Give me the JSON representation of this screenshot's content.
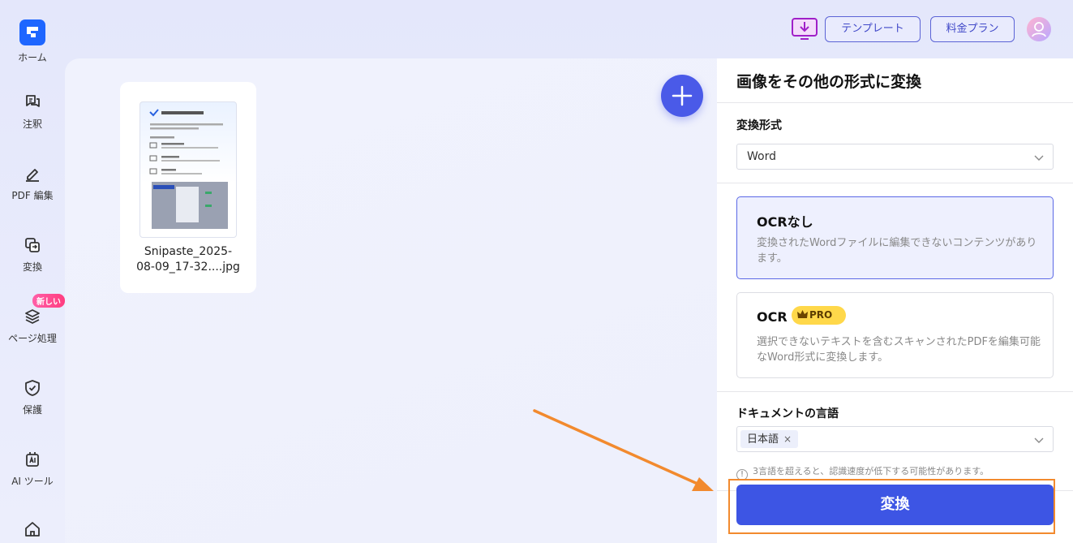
{
  "sidebar": {
    "items": [
      {
        "label": "ホーム",
        "icon": "home-logo-icon"
      },
      {
        "label": "注釈",
        "icon": "comment-icon"
      },
      {
        "label": "PDF 編集",
        "icon": "edit-pen-icon"
      },
      {
        "label": "変換",
        "icon": "convert-icon"
      },
      {
        "label": "ページ処理",
        "icon": "layers-icon"
      },
      {
        "label": "保護",
        "icon": "shield-icon"
      },
      {
        "label": "AI ツール",
        "icon": "ai-tool-icon"
      },
      {
        "label": "",
        "icon": "house-icon"
      }
    ],
    "new_badge": "新しい"
  },
  "header": {
    "template_label": "テンプレート",
    "pricing_label": "料金プラン"
  },
  "file": {
    "name_line1": "Snipaste_2025-",
    "name_line2": "08-09_17-32....jpg"
  },
  "panel": {
    "title": "画像をその他の形式に変換",
    "format_label": "変換形式",
    "format_value": "Word",
    "option_no_ocr": {
      "title": "OCRなし",
      "desc": "変換されたWordファイルに編集できないコンテンツがあります。"
    },
    "option_ocr": {
      "title": "OCR",
      "badge": "PRO",
      "desc": "選択できないテキストを含むスキャンされたPDFを編集可能なWord形式に変換します。"
    },
    "language_label": "ドキュメントの言語",
    "language_tag": "日本語",
    "warning": "3言語を超えると、認識速度が低下する可能性があります。",
    "convert_label": "変換"
  },
  "colors": {
    "accent": "#3d55e4",
    "highlight_outline": "#f28a2e",
    "pro_badge": "#ffd84a",
    "selected_option_bg": "#eef0fe"
  }
}
